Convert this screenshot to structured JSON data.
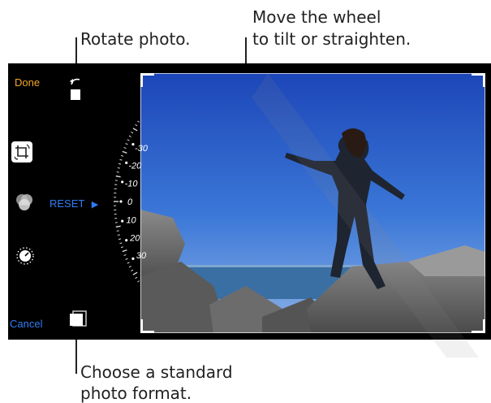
{
  "callouts": {
    "rotate": "Rotate photo.",
    "wheel_line1": "Move the wheel",
    "wheel_line2": "to tilt or straighten.",
    "format_line1": "Choose a standard",
    "format_line2": "photo format."
  },
  "toolbar": {
    "done_label": "Done",
    "cancel_label": "Cancel",
    "reset_label": "RESET"
  },
  "dial": {
    "labels": [
      "-30",
      "-20",
      "-10",
      "0",
      "10",
      "20",
      "30"
    ]
  },
  "colors": {
    "done": "#f5a623",
    "accent_blue": "#2f7cf6",
    "background": "#000000"
  },
  "icons": {
    "rotate": "rotate-icon",
    "crop": "crop-rotate-icon",
    "filters": "filters-icon",
    "adjust": "adjust-dial-icon",
    "aspect": "aspect-ratio-icon",
    "reset_arrow": "play-arrow-icon"
  }
}
